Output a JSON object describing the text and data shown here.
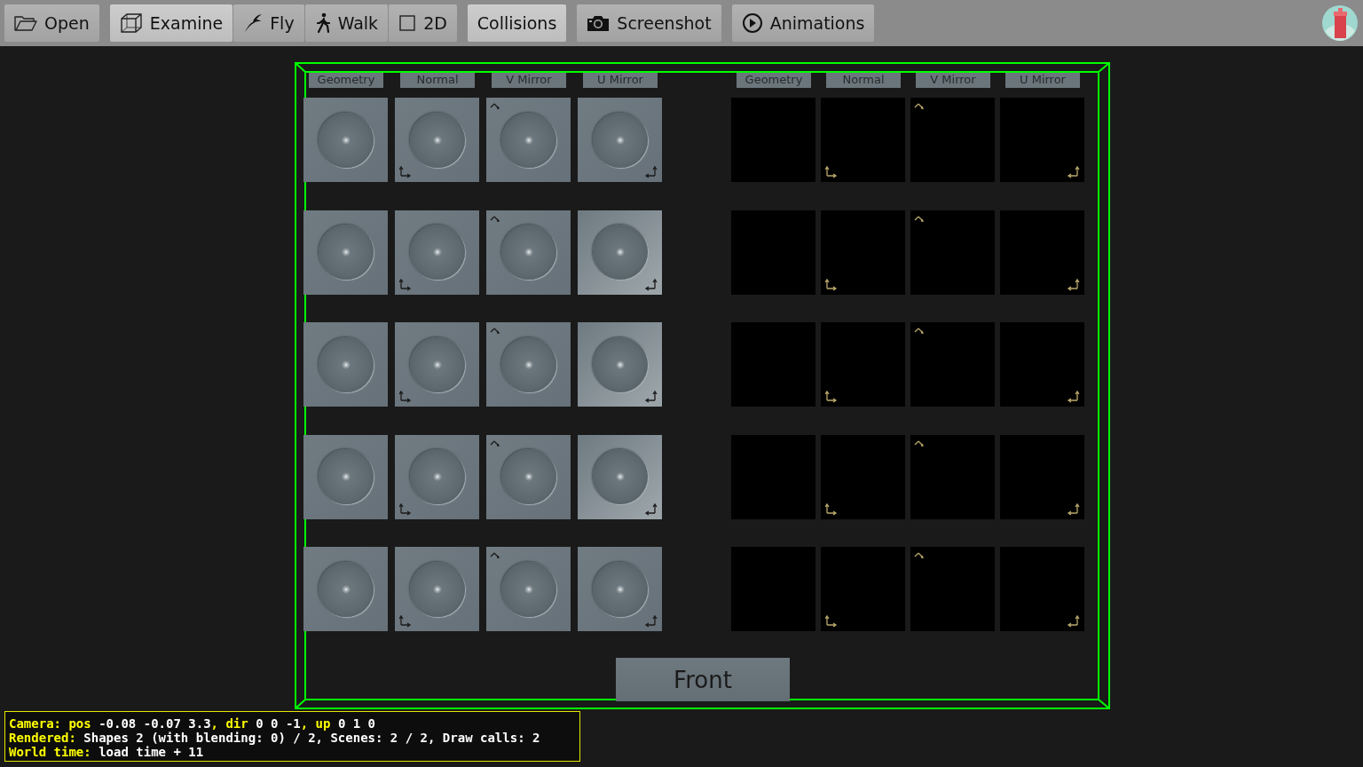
{
  "toolbar": {
    "open": {
      "label": "Open"
    },
    "navigation": [
      {
        "label": "Examine",
        "selected": true
      },
      {
        "label": "Fly",
        "selected": false
      },
      {
        "label": "Walk",
        "selected": false
      },
      {
        "label": "2D",
        "selected": false
      }
    ],
    "collisions": {
      "label": "Collisions",
      "on": true
    },
    "screenshot": {
      "label": "Screenshot"
    },
    "animations": {
      "label": "Animations"
    }
  },
  "scene": {
    "lit_panel": {
      "columns": [
        {
          "label": "Geometry",
          "kind": "geometry"
        },
        {
          "label": "Normal",
          "kind": "normal"
        },
        {
          "label": "V Mirror",
          "kind": "v_mirror"
        },
        {
          "label": "U Mirror",
          "kind": "u_mirror"
        }
      ]
    },
    "dark_panel": {
      "columns": [
        {
          "label": "Geometry",
          "kind": "geometry"
        },
        {
          "label": "Normal",
          "kind": "normal"
        },
        {
          "label": "V Mirror",
          "kind": "v_mirror"
        },
        {
          "label": "U Mirror",
          "kind": "u_mirror"
        }
      ]
    },
    "front_button": {
      "label": "Front"
    }
  },
  "status": {
    "lines": [
      [
        {
          "text": "Camera: pos",
          "kind": "key"
        },
        {
          "text": " -0.08 -0.07 3.3",
          "kind": "value"
        },
        {
          "text": ", dir",
          "kind": "key"
        },
        {
          "text": " 0 0 -1",
          "kind": "value"
        },
        {
          "text": ", up",
          "kind": "key"
        },
        {
          "text": " 0 1 0",
          "kind": "value"
        }
      ],
      [
        {
          "text": "Rendered:",
          "kind": "key"
        },
        {
          "text": " Shapes 2 (with blending: 0) / 2, Scenes: 2 / 2, Draw calls: 2",
          "kind": "value"
        }
      ],
      [
        {
          "text": "World time:",
          "kind": "key"
        },
        {
          "text": " load time + 11",
          "kind": "value"
        }
      ]
    ]
  }
}
